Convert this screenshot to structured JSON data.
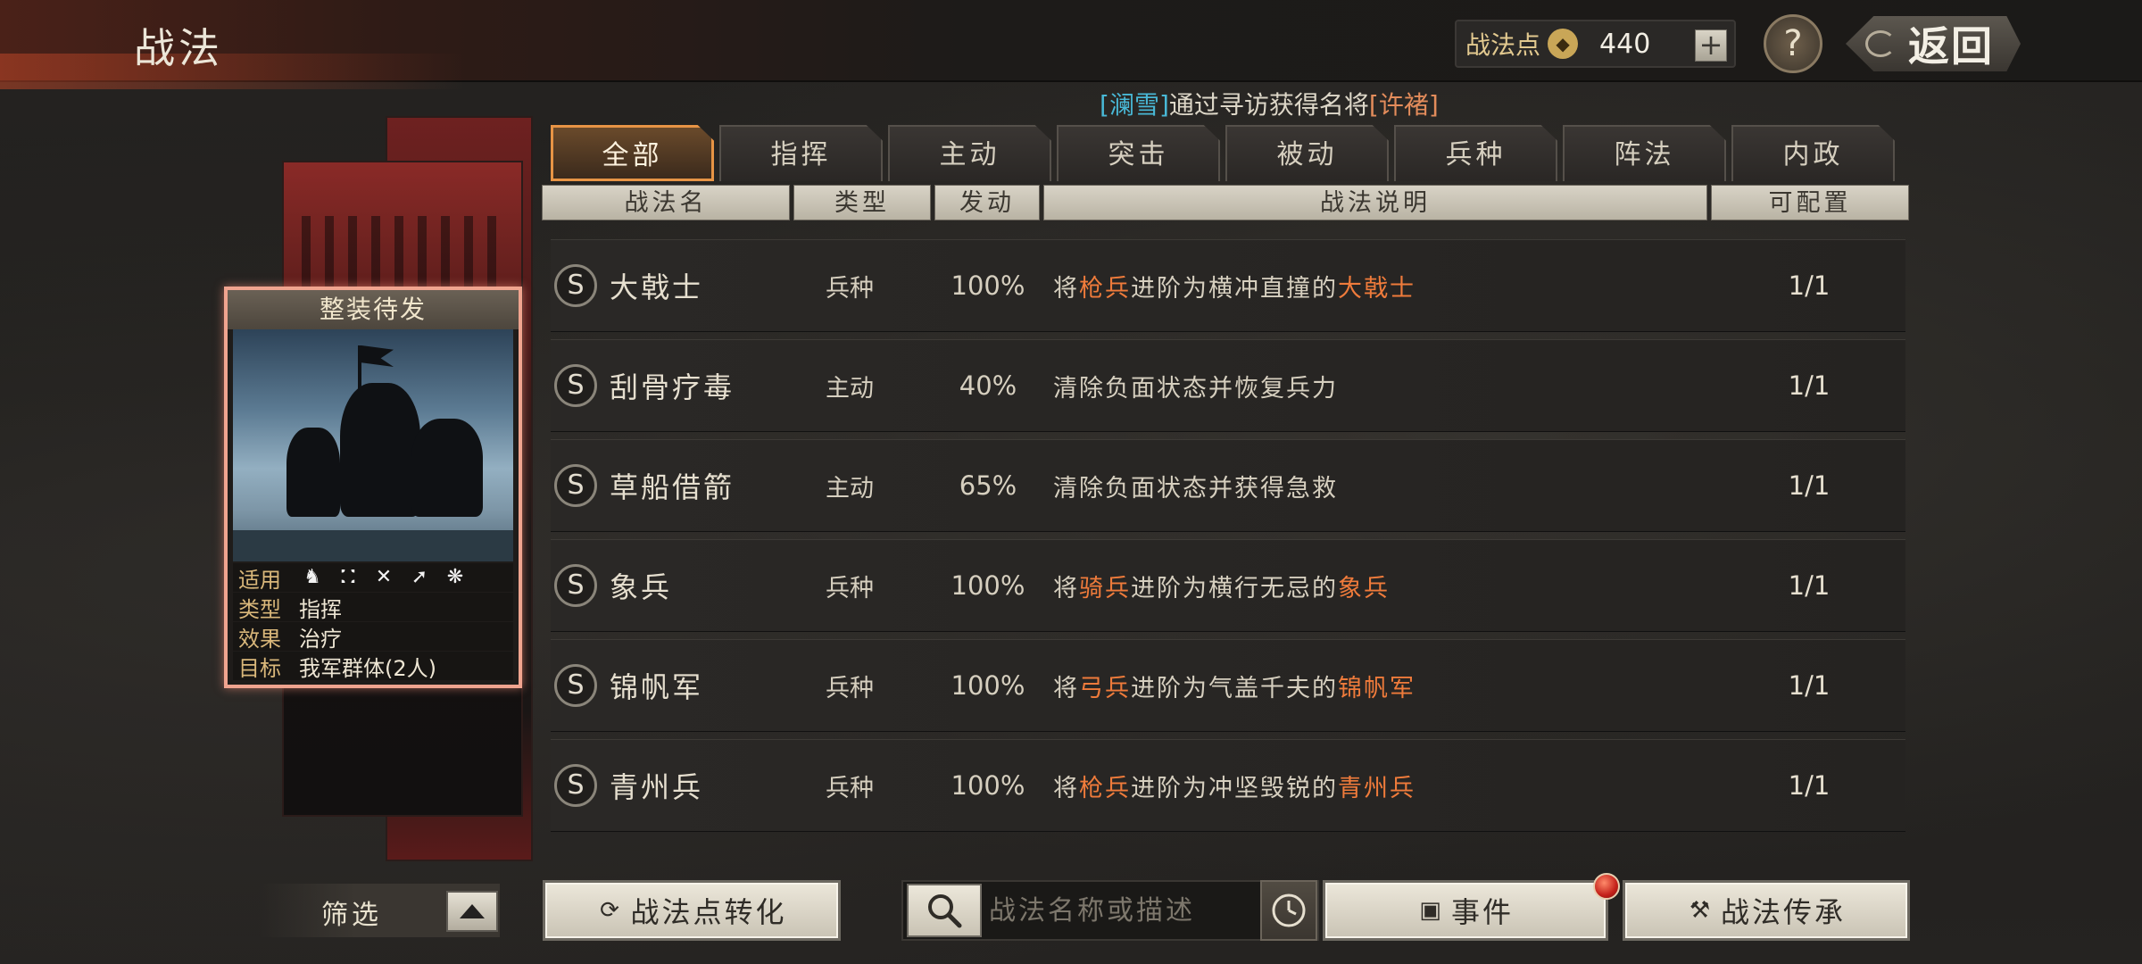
{
  "header": {
    "title": "战法",
    "points_label": "战法点",
    "points_value": "440",
    "plus_label": "+",
    "help_label": "?",
    "back_label": "返回"
  },
  "notice": {
    "prefix_open": "[",
    "name1": "澜雪",
    "prefix_close": "]",
    "middle": "通过寻访获得名将",
    "bracket_open": "[",
    "name2": "许褚",
    "bracket_close": "]"
  },
  "skill_card": {
    "title": "整装待发",
    "props": [
      {
        "key": "适用",
        "value": ""
      },
      {
        "key": "类型",
        "value": "指挥"
      },
      {
        "key": "效果",
        "value": "治疗"
      },
      {
        "key": "目标",
        "value": "我军群体(2人)"
      }
    ],
    "unit_icons": [
      "cavalry-icon",
      "shield-icon",
      "bow-icon",
      "spear-icon",
      "wheel-icon"
    ]
  },
  "tabs": [
    "全部",
    "指挥",
    "主动",
    "突击",
    "被动",
    "兵种",
    "阵法",
    "内政"
  ],
  "active_tab": "全部",
  "columns": [
    "战法名",
    "类型",
    "发动",
    "战法说明",
    "可配置"
  ],
  "rows": [
    {
      "grade": "S",
      "name": "大戟士",
      "type": "兵种",
      "rate": "100%",
      "desc": [
        {
          "t": "将",
          "h": false
        },
        {
          "t": "枪兵",
          "h": true
        },
        {
          "t": "进阶为横冲直撞的",
          "h": false
        },
        {
          "t": "大戟士",
          "h": true
        }
      ],
      "conf": "1/1"
    },
    {
      "grade": "S",
      "name": "刮骨疗毒",
      "type": "主动",
      "rate": "40%",
      "desc": [
        {
          "t": "清除负面状态并恢复兵力",
          "h": false
        }
      ],
      "conf": "1/1"
    },
    {
      "grade": "S",
      "name": "草船借箭",
      "type": "主动",
      "rate": "65%",
      "desc": [
        {
          "t": "清除负面状态并获得急救",
          "h": false
        }
      ],
      "conf": "1/1"
    },
    {
      "grade": "S",
      "name": "象兵",
      "type": "兵种",
      "rate": "100%",
      "desc": [
        {
          "t": "将",
          "h": false
        },
        {
          "t": "骑兵",
          "h": true
        },
        {
          "t": "进阶为横行无忌的",
          "h": false
        },
        {
          "t": "象兵",
          "h": true
        }
      ],
      "conf": "1/1"
    },
    {
      "grade": "S",
      "name": "锦帆军",
      "type": "兵种",
      "rate": "100%",
      "desc": [
        {
          "t": "将",
          "h": false
        },
        {
          "t": "弓兵",
          "h": true
        },
        {
          "t": "进阶为气盖千夫的",
          "h": false
        },
        {
          "t": "锦帆军",
          "h": true
        }
      ],
      "conf": "1/1"
    },
    {
      "grade": "S",
      "name": "青州兵",
      "type": "兵种",
      "rate": "100%",
      "desc": [
        {
          "t": "将",
          "h": false
        },
        {
          "t": "枪兵",
          "h": true
        },
        {
          "t": "进阶为冲坚毁锐的",
          "h": false
        },
        {
          "t": "青州兵",
          "h": true
        }
      ],
      "conf": "1/1"
    }
  ],
  "bottom": {
    "filter_label": "筛选",
    "convert_label": "战法点转化",
    "search_placeholder": "战法名称或描述",
    "events_label": "事件",
    "inherit_label": "战法传承"
  },
  "colors": {
    "highlight": "#ef7b3b",
    "notice_name1": "#49b8d6",
    "notice_name2": "#e38c5b",
    "active_tab_border": "#e79445",
    "card_border": "#f0a48f"
  }
}
